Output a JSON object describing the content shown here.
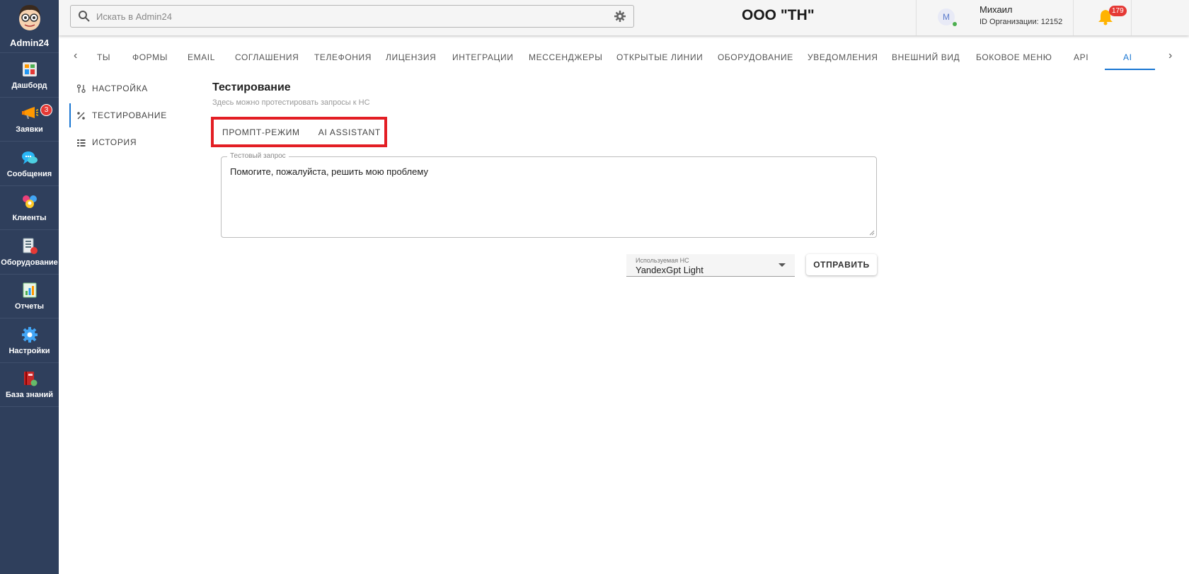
{
  "sidebar": {
    "brand": "Admin24",
    "items": [
      {
        "key": "dashboard",
        "label": "Дашборд",
        "icon": "dashboard-icon",
        "badge": ""
      },
      {
        "key": "requests",
        "label": "Заявки",
        "icon": "megaphone-icon",
        "badge": "3"
      },
      {
        "key": "messages",
        "label": "Сообщения",
        "icon": "chat-icon",
        "badge": ""
      },
      {
        "key": "clients",
        "label": "Клиенты",
        "icon": "clients-icon",
        "badge": ""
      },
      {
        "key": "equipment",
        "label": "Оборудование",
        "icon": "equipment-icon",
        "badge": ""
      },
      {
        "key": "reports",
        "label": "Отчеты",
        "icon": "reports-icon",
        "badge": ""
      },
      {
        "key": "settings",
        "label": "Настройки",
        "icon": "gear-icon",
        "badge": ""
      },
      {
        "key": "knowledge",
        "label": "База знаний",
        "icon": "book-icon",
        "badge": ""
      }
    ]
  },
  "topbar": {
    "search_placeholder": "Искать в Admin24",
    "org_title": "ООО \"ТН\"",
    "user_initial": "М",
    "user_name": "Михаил",
    "user_org": "ID Организации: 12152",
    "notifications_count": "179",
    "help_glyph": "?"
  },
  "tabs": {
    "items": [
      "ТЫ",
      "ФОРМЫ",
      "EMAIL",
      "СОГЛАШЕНИЯ",
      "ТЕЛЕФОНИЯ",
      "ЛИЦЕНЗИЯ",
      "ИНТЕГРАЦИИ",
      "МЕССЕНДЖЕРЫ",
      "ОТКРЫТЫЕ ЛИНИИ",
      "ОБОРУДОВАНИЕ",
      "УВЕДОМЛЕНИЯ",
      "ВНЕШНИЙ ВИД",
      "БОКОВОЕ МЕНЮ",
      "API",
      "AI"
    ],
    "active": "AI"
  },
  "submenu": {
    "items": [
      "НАСТРОЙКА",
      "ТЕСТИРОВАНИЕ",
      "ИСТОРИЯ"
    ],
    "active": "ТЕСТИРОВАНИЕ"
  },
  "content": {
    "title": "Тестирование",
    "subtitle": "Здесь можно протестировать запросы к НС",
    "modes": [
      "ПРОМПТ-РЕЖИМ",
      "AI ASSISTANT"
    ],
    "query_label": "Тестовый запрос",
    "query_value": "Помогите, пожалуйста, решить мою проблему",
    "model_label": "Используемая НС",
    "model_value": "YandexGpt Light",
    "send_label": "ОТПРАВИТЬ"
  },
  "colors": {
    "sidebar_bg": "#2f3f5c",
    "accent": "#1976d2",
    "highlight_box": "#e31e24",
    "badge": "#e53935"
  }
}
